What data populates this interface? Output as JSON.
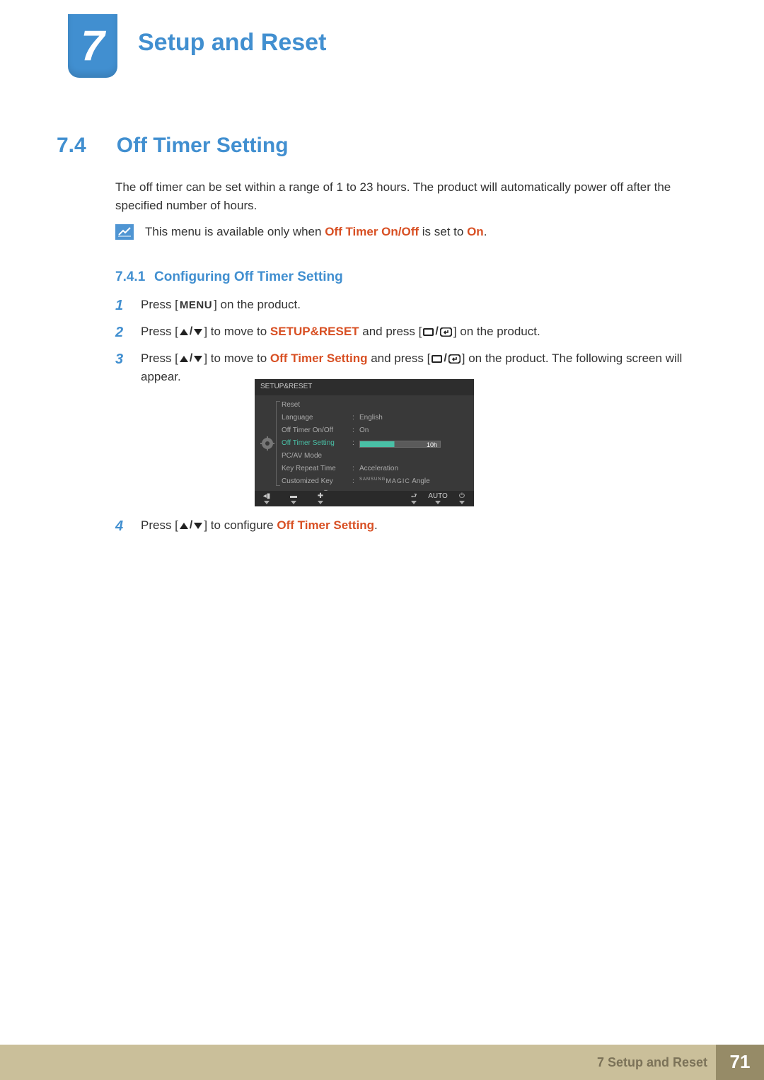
{
  "chapter": {
    "number": "7",
    "title": "Setup and Reset"
  },
  "section": {
    "number": "7.4",
    "title": "Off Timer Setting"
  },
  "intro": "The off timer can be set within a range of 1 to 23 hours. The product will automatically power off after the specified number of hours.",
  "note": {
    "pre": "This menu is available only when ",
    "hl1": "Off Timer On/Off",
    "mid": " is set to ",
    "hl2": "On",
    "post": "."
  },
  "subsection": {
    "number": "7.4.1",
    "title": "Configuring Off Timer Setting"
  },
  "steps": {
    "s1": {
      "n": "1",
      "pre": "Press [",
      "menu": "MENU",
      "post": "] on the product."
    },
    "s2": {
      "n": "2",
      "pre": "Press [",
      "mid1": "] to move to ",
      "t1": "SETUP&RESET",
      "mid2": " and press [",
      "post": "] on the product."
    },
    "s3": {
      "n": "3",
      "pre": "Press [",
      "mid1": "] to move to ",
      "t1": "Off Timer Setting",
      "mid2": " and press [",
      "post": "] on the product. The following screen will appear."
    },
    "s4": {
      "n": "4",
      "pre": "Press [",
      "mid": "] to configure ",
      "t1": "Off Timer Setting",
      "post": "."
    }
  },
  "osd": {
    "title": "SETUP&RESET",
    "rows": {
      "reset": "Reset",
      "language": "Language",
      "language_v": "English",
      "onoff": "Off Timer On/Off",
      "onoff_v": "On",
      "setting": "Off Timer Setting",
      "setting_v": "10h",
      "pcav": "PC/AV Mode",
      "keyrep": "Key Repeat Time",
      "keyrep_v": "Acceleration",
      "custom": "Customized Key",
      "custom_brand": "SAMSUNG",
      "custom_v": " Angle",
      "custom_magic": "MAGIC"
    },
    "footer": {
      "auto": "AUTO"
    }
  },
  "footer": {
    "text": "7 Setup and Reset",
    "page": "71"
  }
}
